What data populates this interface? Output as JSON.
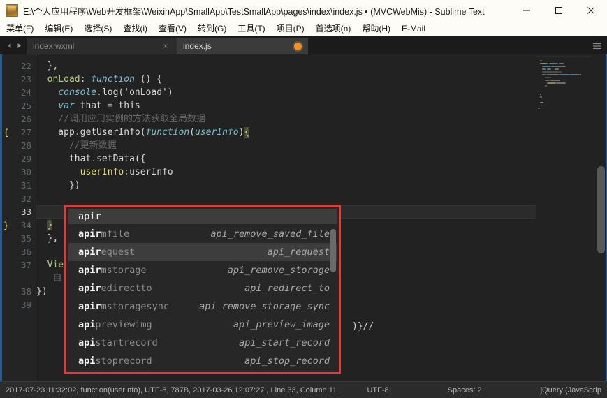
{
  "window": {
    "title": "E:\\个人应用程序\\Web开发框架\\WeixinApp\\SmallApp\\TestSmallApp\\pages\\index\\index.js • (MVCWebMis) - Sublime Text",
    "icon": "sublime-text-icon",
    "controls": {
      "minimize": "minimize-icon",
      "maximize": "maximize-icon",
      "close": "close-icon"
    }
  },
  "menubar": {
    "items": [
      {
        "label": "菜单(F)"
      },
      {
        "label": "编辑(E)"
      },
      {
        "label": "选择(S)"
      },
      {
        "label": "查找(i)"
      },
      {
        "label": "查看(V)"
      },
      {
        "label": "转到(G)"
      },
      {
        "label": "工具(T)"
      },
      {
        "label": "项目(P)"
      },
      {
        "label": "首选项(n)"
      },
      {
        "label": "帮助(H)"
      },
      {
        "label": "E-Mail"
      }
    ]
  },
  "tabbar": {
    "prev_arrow": "chevron-left-icon",
    "next_arrow": "chevron-right-icon",
    "menu_icon": "hamburger-menu-icon",
    "tabs": [
      {
        "label": "index.wxml",
        "active": false,
        "dirty": false,
        "close": "×"
      },
      {
        "label": "index.js",
        "active": true,
        "dirty": true,
        "close": ""
      }
    ]
  },
  "editor": {
    "active_line": 33,
    "lines": [
      {
        "num": "22",
        "mark": "",
        "tokens": [
          {
            "t": "  },",
            "c": "k-plain"
          }
        ]
      },
      {
        "num": "23",
        "mark": "",
        "tokens": [
          {
            "t": "  ",
            "c": "k-plain"
          },
          {
            "t": "onLoad",
            "c": "k-key"
          },
          {
            "t": ": ",
            "c": "k-plain"
          },
          {
            "t": "function",
            "c": "k-fn"
          },
          {
            "t": " () {",
            "c": "k-plain"
          }
        ]
      },
      {
        "num": "24",
        "mark": "",
        "tokens": [
          {
            "t": "    ",
            "c": "k-plain"
          },
          {
            "t": "console",
            "c": "k-var"
          },
          {
            "t": ".",
            "c": "k-dot"
          },
          {
            "t": "log",
            "c": "k-plain"
          },
          {
            "t": "('onLoad')",
            "c": "k-plain"
          }
        ]
      },
      {
        "num": "25",
        "mark": "",
        "tokens": [
          {
            "t": "    ",
            "c": "k-plain"
          },
          {
            "t": "var",
            "c": "k-var"
          },
          {
            "t": " that ",
            "c": "k-plain"
          },
          {
            "t": "=",
            "c": "k-dot"
          },
          {
            "t": " this",
            "c": "k-plain"
          }
        ]
      },
      {
        "num": "26",
        "mark": "",
        "tokens": [
          {
            "t": "    //调用应用实例的方法获取全局数据",
            "c": "k-comment"
          }
        ]
      },
      {
        "num": "27",
        "mark": "{",
        "tokens": [
          {
            "t": "    app",
            "c": "k-plain"
          },
          {
            "t": ".",
            "c": "k-dot"
          },
          {
            "t": "getUserInfo",
            "c": "k-plain"
          },
          {
            "t": "(",
            "c": "k-plain"
          },
          {
            "t": "function",
            "c": "k-fn"
          },
          {
            "t": "(",
            "c": "k-plain"
          },
          {
            "t": "userInfo",
            "c": "k-var"
          },
          {
            "t": ")",
            "c": "k-plain"
          },
          {
            "t": "{",
            "c": "k-bracket"
          }
        ]
      },
      {
        "num": "28",
        "mark": "",
        "tokens": [
          {
            "t": "      //更新数据",
            "c": "k-comment"
          }
        ]
      },
      {
        "num": "29",
        "mark": "",
        "tokens": [
          {
            "t": "      that",
            "c": "k-plain"
          },
          {
            "t": ".",
            "c": "k-dot"
          },
          {
            "t": "setData({",
            "c": "k-plain"
          }
        ]
      },
      {
        "num": "30",
        "mark": "",
        "tokens": [
          {
            "t": "        ",
            "c": "k-plain"
          },
          {
            "t": "userInfo",
            "c": "k-prop"
          },
          {
            "t": ":",
            "c": "k-dot"
          },
          {
            "t": "userInfo",
            "c": "k-plain"
          }
        ]
      },
      {
        "num": "31",
        "mark": "",
        "tokens": [
          {
            "t": "      })",
            "c": "k-plain"
          }
        ]
      },
      {
        "num": "32",
        "mark": "",
        "tokens": [
          {
            "t": "",
            "c": "k-plain"
          }
        ]
      },
      {
        "num": "33",
        "mark": "",
        "tokens": [
          {
            "t": "",
            "c": "k-plain"
          }
        ]
      },
      {
        "num": "34",
        "mark": "}",
        "tokens": [
          {
            "t": "  ",
            "c": "k-plain"
          },
          {
            "t": "}",
            "c": "k-bracket"
          }
        ]
      },
      {
        "num": "35",
        "mark": "",
        "tokens": [
          {
            "t": "  },",
            "c": "k-plain"
          }
        ]
      },
      {
        "num": "36",
        "mark": "",
        "tokens": [
          {
            "t": "",
            "c": "k-plain"
          }
        ]
      },
      {
        "num": "37",
        "mark": "",
        "tokens": [
          {
            "t": "  ",
            "c": "k-plain"
          },
          {
            "t": "Vie",
            "c": "k-key"
          }
        ]
      },
      {
        "num": "",
        "mark": "",
        "tokens": [
          {
            "t": "   自",
            "c": "k-comment"
          }
        ]
      },
      {
        "num": "38",
        "mark": "",
        "tokens": [
          {
            "t": "})",
            "c": "k-plain"
          }
        ]
      },
      {
        "num": "39",
        "mark": "",
        "tokens": [
          {
            "t": "",
            "c": "k-plain"
          }
        ]
      }
    ],
    "overflow_text": ")}//",
    "minimap": "code-minimap",
    "scrollbar": "vertical-scrollbar"
  },
  "autocomplete": {
    "input_value": "apir",
    "scrollbar": "popup-scrollbar",
    "selected_index": 1,
    "rows": [
      {
        "match": "apir",
        "rest": "mfile",
        "desc": "api_remove_saved_file"
      },
      {
        "match": "apir",
        "rest": "equest",
        "desc": "api_request"
      },
      {
        "match": "apir",
        "rest": "mstorage",
        "desc": "api_remove_storage"
      },
      {
        "match": "apir",
        "rest": "edirectto",
        "desc": "api_redirect_to"
      },
      {
        "match": "apir",
        "rest": "mstoragesync",
        "desc": "api_remove_storage_sync"
      },
      {
        "match": "api",
        "rest": "previewimg",
        "desc": "api_preview_image"
      },
      {
        "match": "api",
        "rest": "startrecord",
        "desc": "api_start_record"
      },
      {
        "match": "api",
        "rest": "stoprecord",
        "desc": "api_stop_record"
      }
    ]
  },
  "statusbar": {
    "left": "2017-07-23 11:32:02, function(userInfo), UTF-8, 787B, 2017-03-26 12:07:27 , Line 33, Column 11",
    "encoding": "UTF-8",
    "indentation": "Spaces: 2",
    "syntax": "jQuery (JavaScrip"
  },
  "colors": {
    "accent": "#f59122",
    "popup_border": "#e23b3b",
    "editor_bg": "#222222",
    "titlebar_bg": "#fdfcf6"
  }
}
